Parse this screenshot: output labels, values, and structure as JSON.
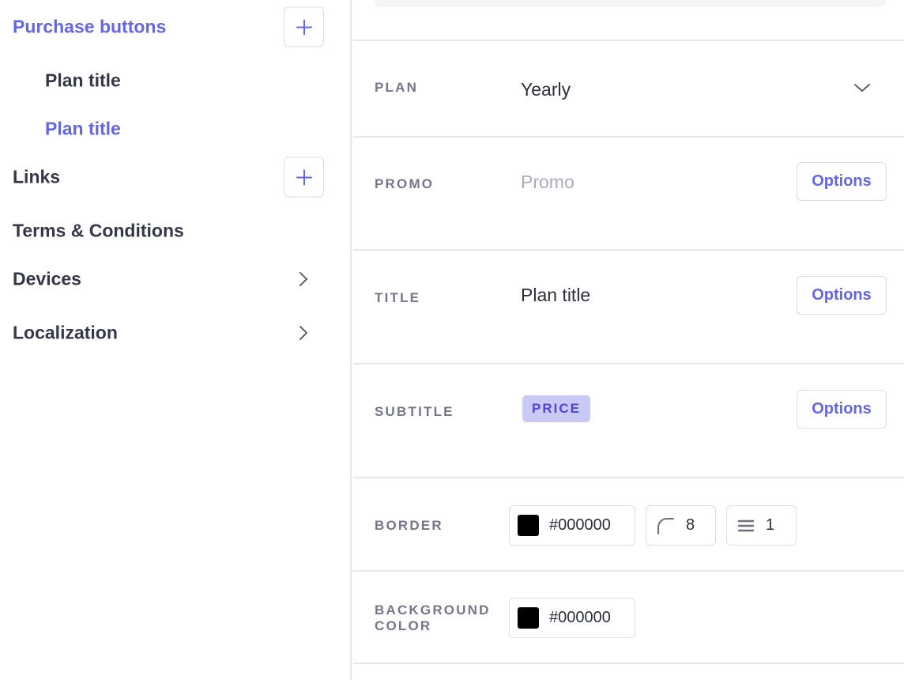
{
  "sidebar": {
    "purchase_buttons": "Purchase buttons",
    "plan_title_1": "Plan title",
    "plan_title_2": "Plan title",
    "links": "Links",
    "terms": "Terms & Conditions",
    "devices": "Devices",
    "localization": "Localization"
  },
  "sections": {
    "plan": {
      "label": "PLAN",
      "value": "Yearly"
    },
    "promo": {
      "label": "PROMO",
      "placeholder": "Promo",
      "options": "Options"
    },
    "title": {
      "label": "TITLE",
      "value": "Plan title",
      "options": "Options"
    },
    "subtitle": {
      "label": "SUBTITLE",
      "tag": "PRICE",
      "options": "Options"
    },
    "border": {
      "label": "BORDER",
      "color": "#000000",
      "radius": "8",
      "width": "1"
    },
    "background": {
      "label_line1": "BACKGROUND",
      "label_line2": "COLOR",
      "color": "#000000"
    }
  },
  "colors": {
    "accent": "#6366e8",
    "swatch": "#000000",
    "tag_bg": "#c9c9f5",
    "divider": "#e6e7ec"
  },
  "icons": [
    "plus-icon",
    "chevron-right-icon",
    "chevron-down-icon",
    "corner-radius-icon",
    "border-width-icon"
  ]
}
